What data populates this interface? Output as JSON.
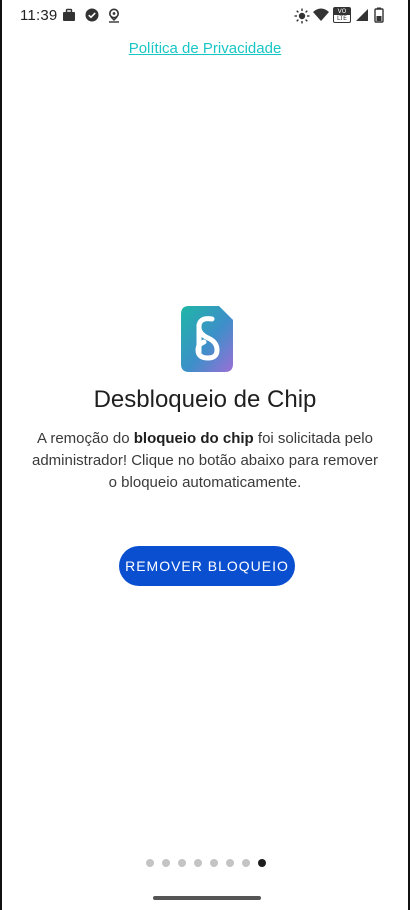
{
  "status_bar": {
    "time": "11:39",
    "left_icons": [
      "briefcase-icon",
      "check-circle-icon",
      "location-icon"
    ],
    "right_icons": [
      "brightness-icon",
      "wifi-icon",
      "volte-icon",
      "signal-icon",
      "battery-icon"
    ],
    "volte_top": "VO",
    "volte_bottom": "LTE"
  },
  "header": {
    "privacy_link": "Política de Privacidade"
  },
  "main": {
    "title": "Desbloqueio de Chip",
    "description_before": "A remoção do ",
    "description_bold": "bloqueio do chip",
    "description_after": " foi solicitada pelo administrador! Clique no botão abaixo para remover o bloqueio automaticamente.",
    "button_label": "REMOVER BLOQUEIO"
  },
  "pagination": {
    "total": 8,
    "active_index": 7
  },
  "colors": {
    "link": "#19c6c6",
    "button": "#0b4fd1",
    "logo_gradient_start": "#1fb6a6",
    "logo_gradient_end": "#9b6fd6"
  }
}
